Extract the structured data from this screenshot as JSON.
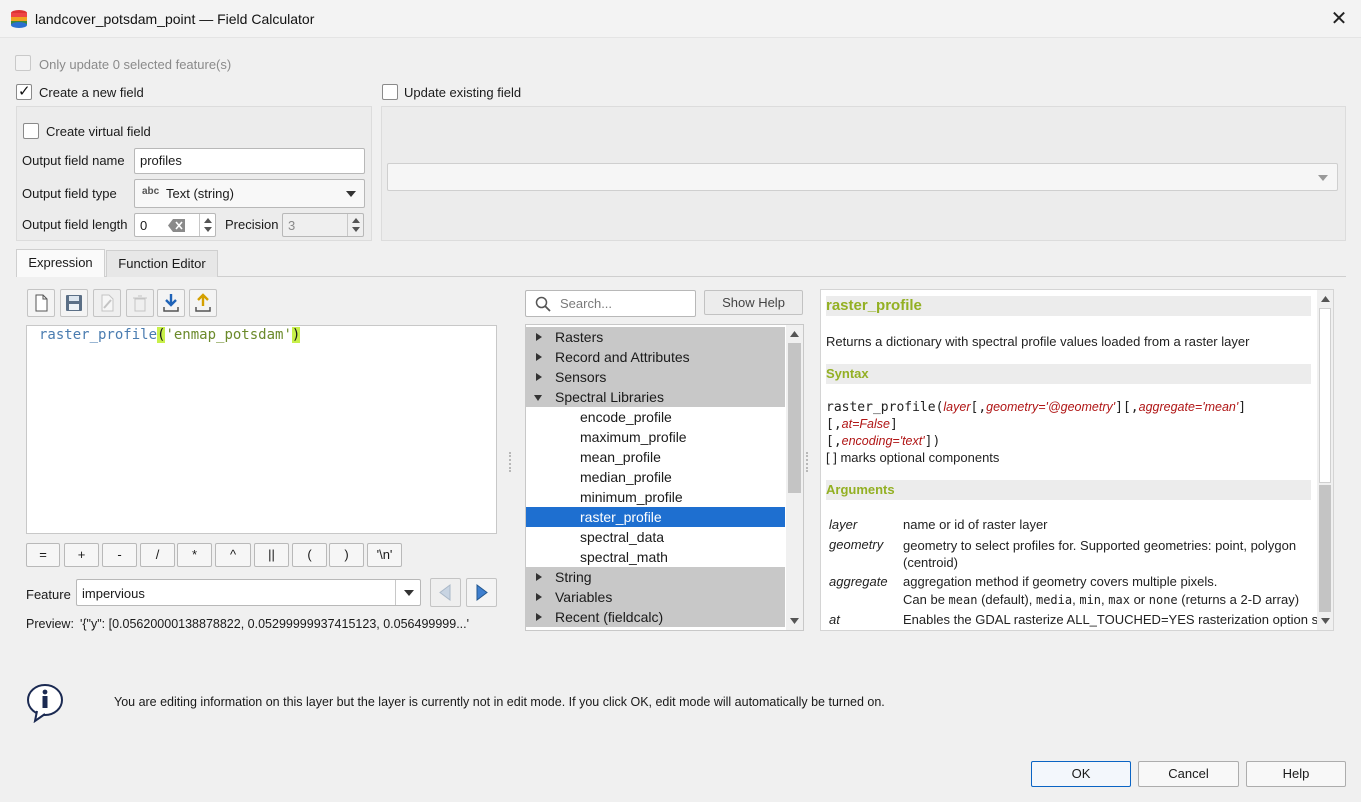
{
  "window": {
    "title": "landcover_potsdam_point — Field Calculator",
    "close_glyph": "✕",
    "icon": "database-layer-icon"
  },
  "options": {
    "only_selected_label": "Only update 0 selected feature(s)",
    "only_selected_checked": false,
    "create_new_label": "Create a new field",
    "create_new_checked": true,
    "update_existing_label": "Update existing field",
    "update_existing_checked": false
  },
  "new_field": {
    "virtual_label": "Create virtual field",
    "virtual_checked": false,
    "name_label": "Output field name",
    "name_value": "profiles",
    "type_label": "Output field type",
    "type_badge": "abc",
    "type_value": "Text (string)",
    "length_label": "Output field length",
    "length_value": "0",
    "precision_label": "Precision",
    "precision_value": "3"
  },
  "tabs": {
    "expression": "Expression",
    "function_editor": "Function Editor"
  },
  "expression": {
    "func": "raster_profile",
    "open_paren": "(",
    "arg": "'enmap_potsdam'",
    "close_paren": ")"
  },
  "operators": [
    "=",
    "+",
    "-",
    "/",
    "*",
    "^",
    "||",
    "(",
    ")",
    "'\\n'"
  ],
  "feature": {
    "label": "Feature",
    "value": "impervious"
  },
  "preview": {
    "label": "Preview:",
    "value": "'{\"y\": [0.05620000138878822, 0.05299999937415123, 0.056499999...'"
  },
  "search": {
    "placeholder": "Search...",
    "show_help": "Show Help"
  },
  "tree": {
    "items": [
      {
        "label": "Rasters",
        "kind": "group"
      },
      {
        "label": "Record and Attributes",
        "kind": "group"
      },
      {
        "label": "Sensors",
        "kind": "group"
      },
      {
        "label": "Spectral Libraries",
        "kind": "group-open"
      },
      {
        "label": "encode_profile",
        "kind": "leaf"
      },
      {
        "label": "maximum_profile",
        "kind": "leaf"
      },
      {
        "label": "mean_profile",
        "kind": "leaf"
      },
      {
        "label": "median_profile",
        "kind": "leaf"
      },
      {
        "label": "minimum_profile",
        "kind": "leaf"
      },
      {
        "label": "raster_profile",
        "kind": "selected"
      },
      {
        "label": "spectral_data",
        "kind": "leaf"
      },
      {
        "label": "spectral_math",
        "kind": "leaf"
      },
      {
        "label": "String",
        "kind": "group"
      },
      {
        "label": "Variables",
        "kind": "group"
      },
      {
        "label": "Recent (fieldcalc)",
        "kind": "group"
      }
    ]
  },
  "help": {
    "title": "raster_profile",
    "description": "Returns a dictionary with spectral profile values loaded from a raster layer",
    "syntax_header": "Syntax",
    "syntax_func": "raster_profile",
    "syntax_p1": "layer",
    "syntax_p2": "geometry='@geometry'",
    "syntax_p3": "aggregate='mean'",
    "syntax_p4": "at=False",
    "syntax_p5": "encoding='text'",
    "optional_note": "[ ] marks optional components",
    "arguments_header": "Arguments",
    "arguments": [
      {
        "name": "layer",
        "desc": "name or id of raster layer"
      },
      {
        "name": "geometry",
        "desc": "geometry to select profiles for. Supported geometries: point, polygon (centroid)"
      },
      {
        "name": "aggregate",
        "desc": "aggregation method if geometry covers multiple pixels."
      },
      {
        "name": "at",
        "desc": "Enables the GDAL rasterize ALL_TOUCHED=YES rasterization option so"
      }
    ],
    "aggregate_more_1": "Can be ",
    "aggregate_mean": "mean",
    "aggregate_more_2": " (default), ",
    "aggregate_media": "media",
    "aggregate_min": "min",
    "aggregate_max": "max",
    "aggregate_or": " or ",
    "aggregate_none": "none",
    "aggregate_more_3": " (returns a 2-D array)"
  },
  "info": {
    "message": "You are editing information on this layer but the layer is currently not in edit mode. If you click OK, edit mode will automatically be turned on."
  },
  "buttons": {
    "ok": "OK",
    "cancel": "Cancel",
    "help": "Help"
  },
  "colors": {
    "accent": "#1e6fd0",
    "help_header": "#93b023",
    "argument_name": "#b01515",
    "code_function": "#4a7cb0",
    "code_string": "#6b8a2a",
    "paren_highlight": "#c8f04a"
  }
}
